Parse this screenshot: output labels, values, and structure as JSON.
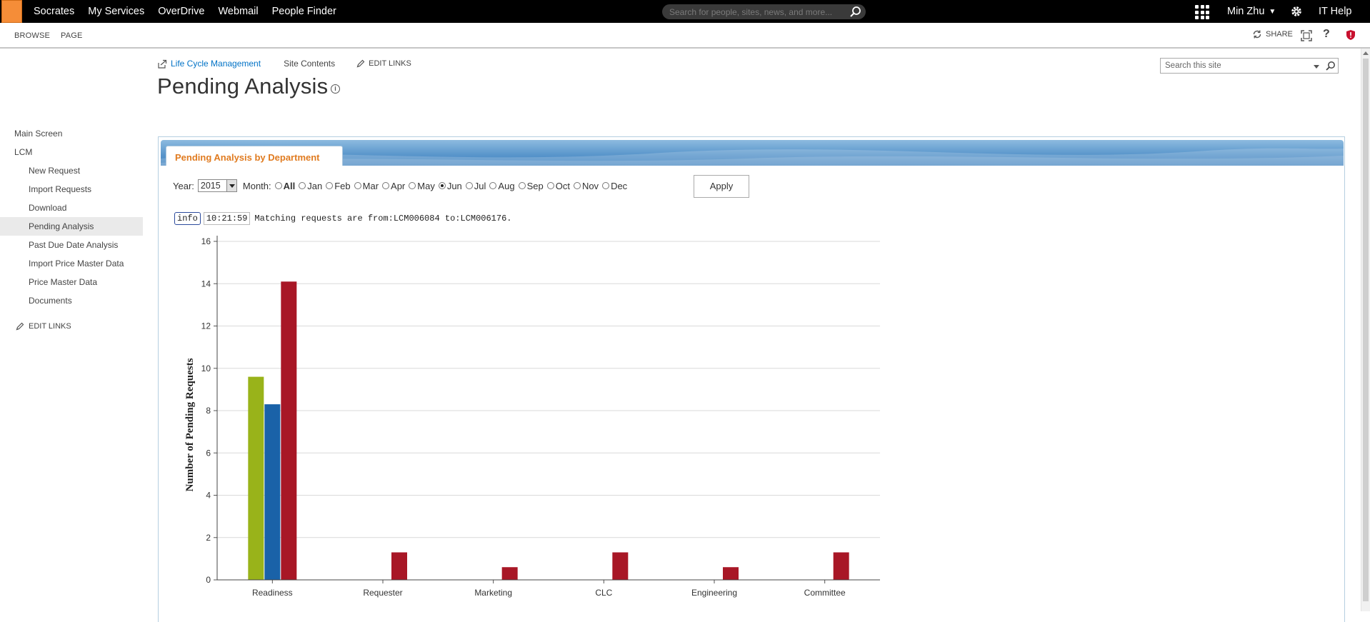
{
  "suitebar": {
    "links": [
      "Socrates",
      "My Services",
      "OverDrive",
      "Webmail",
      "People Finder"
    ],
    "search_placeholder": "Search for people, sites, news, and more...",
    "user": "Min Zhu",
    "ithelp": "IT Help"
  },
  "ribbon": {
    "browse": "BROWSE",
    "page": "PAGE",
    "share": "SHARE"
  },
  "breadcrumb": {
    "site_link": "Life Cycle Management",
    "site_contents": "Site Contents",
    "edit_links": "EDIT LINKS"
  },
  "page": {
    "title": "Pending Analysis",
    "search_placeholder": "Search this site"
  },
  "leftnav": {
    "items": [
      {
        "label": "Main Screen",
        "level": "top"
      },
      {
        "label": "LCM",
        "level": "top"
      },
      {
        "label": "New Request",
        "level": "sub"
      },
      {
        "label": "Import Requests",
        "level": "sub"
      },
      {
        "label": "Download",
        "level": "sub"
      },
      {
        "label": "Pending Analysis",
        "level": "sub",
        "selected": true
      },
      {
        "label": "Past Due Date Analysis",
        "level": "sub"
      },
      {
        "label": "Import Price Master Data",
        "level": "sub"
      },
      {
        "label": "Price Master Data",
        "level": "sub"
      },
      {
        "label": "Documents",
        "level": "sub"
      }
    ],
    "edit_links": "EDIT LINKS"
  },
  "webpart": {
    "tab_title": "Pending Analysis by Department",
    "year_label": "Year:",
    "year_value": "2015",
    "month_label": "Month:",
    "months": [
      "All",
      "Jan",
      "Feb",
      "Mar",
      "Apr",
      "May",
      "Jun",
      "Jul",
      "Aug",
      "Sep",
      "Oct",
      "Nov",
      "Dec"
    ],
    "selected_month": "Jun",
    "apply_label": "Apply",
    "info_badge": "info",
    "info_time": "10:21:59",
    "info_message": "Matching requests are from:LCM006084 to:LCM006176."
  },
  "colors": {
    "series_green": "#99b31a",
    "series_blue": "#1a62a8",
    "series_red": "#a81726",
    "accent_orange": "#e07b20"
  },
  "chart_data": {
    "type": "bar",
    "ylabel": "Number of Pending Requests",
    "ylim": [
      0,
      16
    ],
    "yticks": [
      0,
      2,
      4,
      6,
      8,
      10,
      12,
      14,
      16
    ],
    "categories": [
      "Readiness",
      "Requester",
      "Marketing",
      "CLC",
      "Engineering",
      "Committee"
    ],
    "grid": true,
    "series": [
      {
        "color": "#99b31a",
        "values": [
          9.6,
          0,
          0,
          0,
          0,
          0
        ]
      },
      {
        "color": "#1a62a8",
        "values": [
          8.3,
          0,
          0,
          0,
          0,
          0
        ]
      },
      {
        "color": "#a81726",
        "values": [
          14.1,
          1.3,
          0.6,
          1.3,
          0.6,
          1.3
        ]
      }
    ]
  }
}
